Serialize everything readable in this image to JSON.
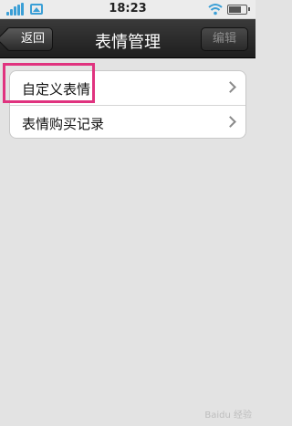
{
  "status_bar": {
    "time": "18:23",
    "icons": [
      "signal-icon",
      "image-icon",
      "wifi-icon",
      "battery-icon"
    ],
    "accent_color": "#3b9fd6"
  },
  "nav": {
    "back_label": "返回",
    "title": "表情管理",
    "edit_label": "编辑"
  },
  "list": {
    "items": [
      {
        "label": "自定义表情",
        "icon": "chevron-right-icon"
      },
      {
        "label": "表情购买记录",
        "icon": "chevron-right-icon"
      }
    ]
  },
  "annotation": {
    "highlight_color": "#e0337f"
  },
  "watermark": {
    "text": "Baidu 经验"
  }
}
